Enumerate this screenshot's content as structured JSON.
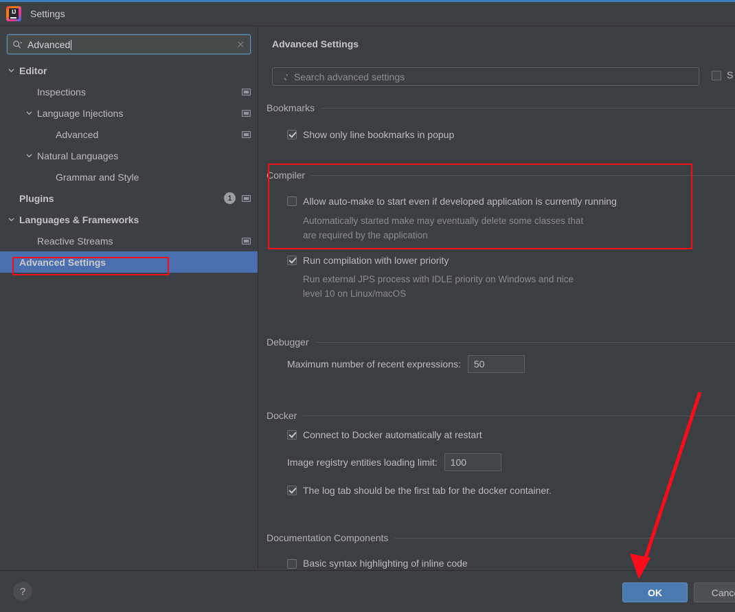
{
  "window": {
    "title": "Settings",
    "logo_icon": "intellij-idea-logo"
  },
  "sidebar": {
    "search": {
      "value": "Advanced",
      "search_icon": "search-icon",
      "clear_icon": "clear-icon"
    },
    "items": [
      {
        "label": "Editor",
        "depth": 0,
        "bold": true,
        "arrow": "chevron-down-icon",
        "modified_icon": false,
        "badge": null,
        "selected": false
      },
      {
        "label": "Inspections",
        "depth": 1,
        "bold": false,
        "arrow": null,
        "modified_icon": true,
        "badge": null,
        "selected": false
      },
      {
        "label": "Language Injections",
        "depth": 1,
        "bold": false,
        "arrow": "chevron-down-icon",
        "modified_icon": true,
        "badge": null,
        "selected": false
      },
      {
        "label": "Advanced",
        "depth": 2,
        "bold": false,
        "arrow": null,
        "modified_icon": true,
        "badge": null,
        "selected": false
      },
      {
        "label": "Natural Languages",
        "depth": 1,
        "bold": false,
        "arrow": "chevron-down-icon",
        "modified_icon": false,
        "badge": null,
        "selected": false
      },
      {
        "label": "Grammar and Style",
        "depth": 2,
        "bold": false,
        "arrow": null,
        "modified_icon": false,
        "badge": null,
        "selected": false
      },
      {
        "label": "Plugins",
        "depth": 0,
        "bold": true,
        "arrow": null,
        "modified_icon": true,
        "badge": "1",
        "selected": false
      },
      {
        "label": "Languages & Frameworks",
        "depth": 0,
        "bold": true,
        "arrow": "chevron-down-icon",
        "modified_icon": false,
        "badge": null,
        "selected": false
      },
      {
        "label": "Reactive Streams",
        "depth": 1,
        "bold": false,
        "arrow": null,
        "modified_icon": true,
        "badge": null,
        "selected": false
      },
      {
        "label": "Advanced Settings",
        "depth": 0,
        "bold": true,
        "arrow": null,
        "modified_icon": false,
        "badge": null,
        "selected": true
      }
    ]
  },
  "content": {
    "title": "Advanced Settings",
    "search": {
      "placeholder": "Search advanced settings",
      "search_icon": "search-icon"
    },
    "show_modified": {
      "label": "S",
      "checked": false
    },
    "groups": {
      "bookmarks": {
        "title": "Bookmarks",
        "show_only_line_bookmarks": {
          "label": "Show only line bookmarks in popup",
          "checked": true
        }
      },
      "compiler": {
        "title": "Compiler",
        "allow_automake": {
          "label": "Allow auto-make to start even if developed application is currently running",
          "checked": false,
          "description": "Automatically started make may eventually delete some classes that\nare required by the application"
        },
        "lower_priority": {
          "label": "Run compilation with lower priority",
          "checked": true,
          "description": "Run external JPS process with IDLE priority on Windows and nice\nlevel 10 on Linux/macOS"
        }
      },
      "debugger": {
        "title": "Debugger",
        "max_recent_expressions": {
          "label": "Maximum number of recent expressions:",
          "value": "50"
        }
      },
      "docker": {
        "title": "Docker",
        "connect_at_restart": {
          "label": "Connect to Docker automatically at restart",
          "checked": true
        },
        "image_registry_limit": {
          "label": "Image registry entities loading limit:",
          "value": "100"
        },
        "log_tab_first": {
          "label": "The log tab should be the first tab for the docker container.",
          "checked": true
        }
      },
      "documentation_components": {
        "title": "Documentation Components",
        "basic_syntax_highlighting": {
          "label": "Basic syntax highlighting of inline code",
          "checked": false
        }
      }
    }
  },
  "footer": {
    "help_label": "?",
    "ok_label": "OK",
    "cancel_label": "Cancel"
  },
  "annotations": {
    "highlight_color": "#fb0d1b",
    "arrow_color": "#fb0d1b"
  }
}
